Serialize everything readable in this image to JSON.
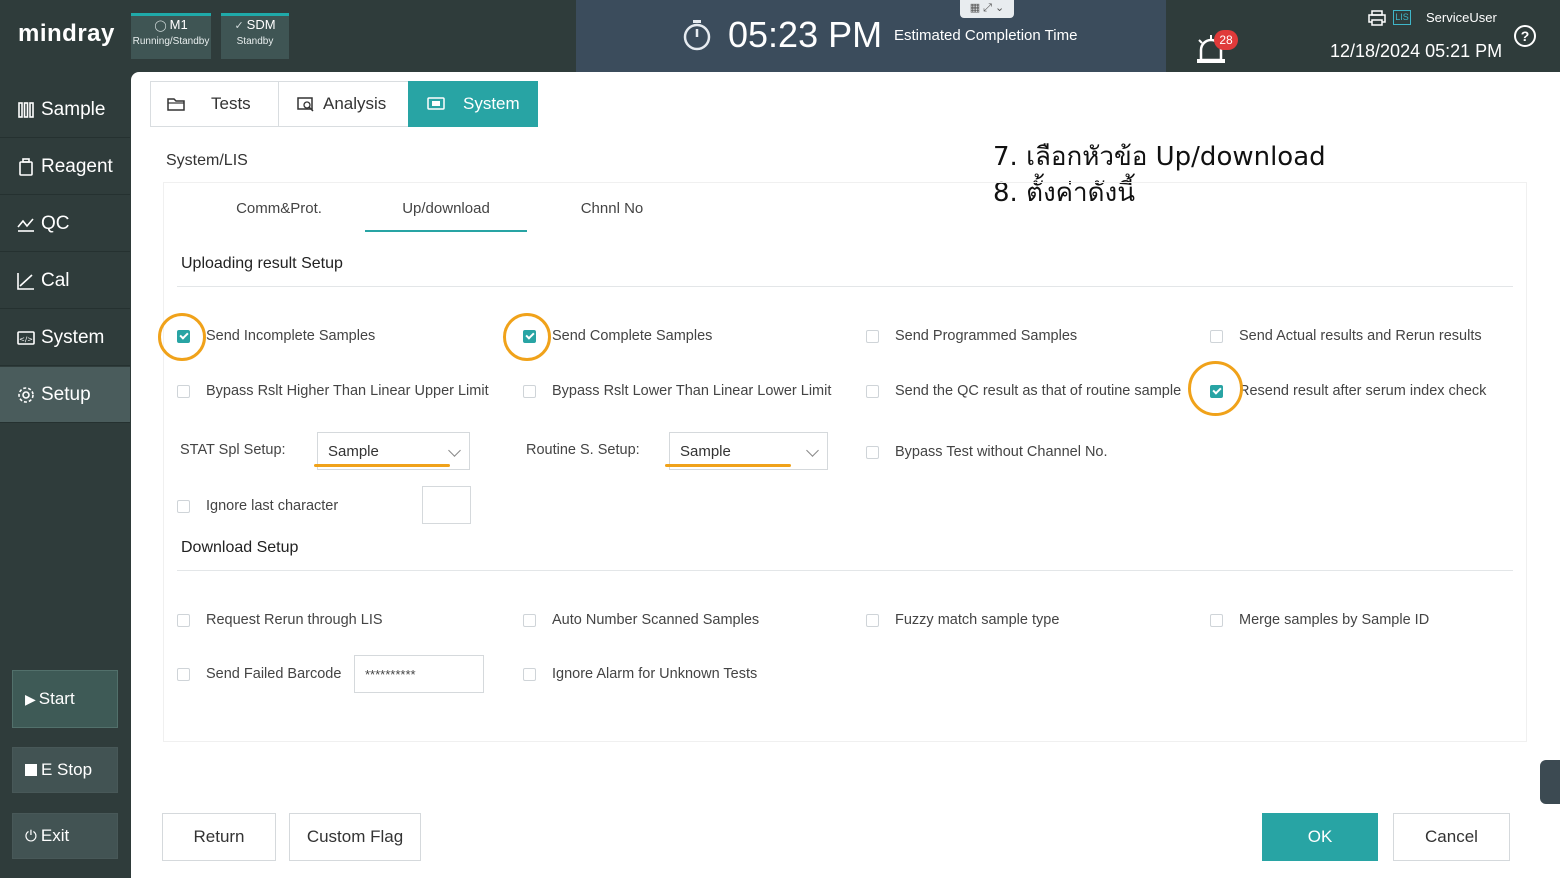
{
  "app": {
    "logo": "mindray"
  },
  "modules": [
    {
      "name": "M1",
      "status": "Running/Standby"
    },
    {
      "name": "SDM",
      "status": "Standby"
    }
  ],
  "clock": {
    "time": "05:23 PM",
    "label": "Estimated Completion Time"
  },
  "alarm": {
    "count": "28"
  },
  "header": {
    "lis_badge": "LIS",
    "user": "ServiceUser",
    "datetime": "12/18/2024 05:21 PM",
    "help": "?"
  },
  "sidebar": {
    "items": [
      {
        "label": "Sample",
        "icon": "sample-icon"
      },
      {
        "label": "Reagent",
        "icon": "reagent-icon"
      },
      {
        "label": "QC",
        "icon": "qc-icon"
      },
      {
        "label": "Cal",
        "icon": "cal-icon"
      },
      {
        "label": "System",
        "icon": "system-icon"
      },
      {
        "label": "Setup",
        "icon": "gear-icon"
      }
    ],
    "active": "Setup",
    "start_label": "Start",
    "estop_label": "E Stop",
    "exit_label": "Exit"
  },
  "tabs": [
    {
      "label": "Tests"
    },
    {
      "label": "Analysis"
    },
    {
      "label": "System",
      "active": true
    }
  ],
  "breadcrumb": "System/LIS",
  "annotations": [
    "7. เลือกหัวข้อ Up/download",
    "8. ตั้งค่าดังนี้"
  ],
  "subtabs": [
    {
      "label": "Comm&Prot."
    },
    {
      "label": "Up/download",
      "active": true
    },
    {
      "label": "Chnnl No"
    }
  ],
  "upload": {
    "title": "Uploading result Setup",
    "options": [
      {
        "label": "Send Incomplete Samples",
        "checked": true
      },
      {
        "label": "Send Complete Samples",
        "checked": true
      },
      {
        "label": "Send Programmed Samples",
        "checked": false
      },
      {
        "label": "Send Actual results and Rerun results",
        "checked": false
      },
      {
        "label": "Bypass Rslt Higher Than Linear Upper Limit",
        "checked": false
      },
      {
        "label": "Bypass Rslt Lower Than Linear Lower Limit",
        "checked": false
      },
      {
        "label": "Send the QC result as that of routine sample",
        "checked": false
      },
      {
        "label": "Resend result after serum index check",
        "checked": true
      },
      {
        "label": "Bypass Test without Channel No.",
        "checked": false
      },
      {
        "label": "Ignore last character",
        "checked": false
      }
    ],
    "stat_label": "STAT Spl Setup:",
    "stat_value": "Sample",
    "routine_label": "Routine S. Setup:",
    "routine_value": "Sample",
    "ignore_value": ""
  },
  "download": {
    "title": "Download Setup",
    "options": [
      {
        "label": "Request Rerun through LIS",
        "checked": false
      },
      {
        "label": "Auto Number Scanned Samples",
        "checked": false
      },
      {
        "label": "Fuzzy match sample type",
        "checked": false
      },
      {
        "label": "Merge samples by Sample ID",
        "checked": false
      },
      {
        "label": "Send Failed Barcode",
        "checked": false
      },
      {
        "label": "Ignore Alarm for Unknown Tests",
        "checked": false
      }
    ],
    "failed_barcode_value": "**********"
  },
  "footer": {
    "return_label": "Return",
    "custom_flag_label": "Custom Flag",
    "ok_label": "OK",
    "cancel_label": "Cancel"
  },
  "colors": {
    "accent": "#28a4a4",
    "highlight": "#f0a21a",
    "sidebar": "#2f3c3b",
    "alarm": "#e03a3a"
  }
}
